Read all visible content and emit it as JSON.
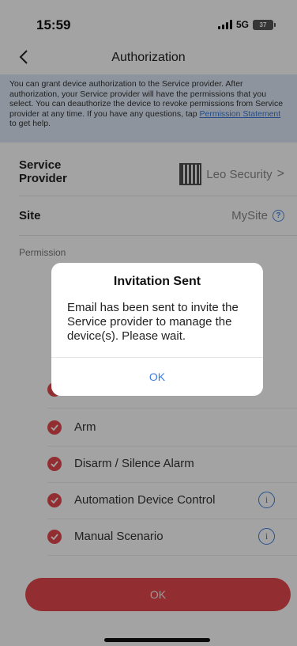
{
  "status_bar": {
    "time": "15:59",
    "network": "5G",
    "battery": "37"
  },
  "nav": {
    "title": "Authorization",
    "back_icon": "chevron-left-icon"
  },
  "info": {
    "text_before": "You can grant device authorization to the Service provider. After authorization, your Service provider will have the permissions that you select. You can deauthorize the device to revoke permissions from Service provider at any time. If you have any questions, tap ",
    "link": "Permission Statement",
    "text_after": " to get help."
  },
  "service_provider": {
    "label": "Service Provider",
    "value": "Leo Security",
    "chevron": ">"
  },
  "site": {
    "label": "Site",
    "value": "MySite",
    "help": "?"
  },
  "permission": {
    "title": "Permission",
    "items": [
      {
        "label": "Arm",
        "info": false
      },
      {
        "label": "Disarm / Silence Alarm",
        "info": false
      },
      {
        "label": "Automation Device Control",
        "info": true
      },
      {
        "label": "Manual Scenario",
        "info": true
      }
    ]
  },
  "bottom_button": {
    "label": "OK"
  },
  "dialog": {
    "title": "Invitation Sent",
    "message": "Email has been sent to invite the Service provider to manage the device(s). Please wait.",
    "ok": "OK"
  },
  "colors": {
    "accent_red": "#e5484d",
    "link_blue": "#3a7fe0",
    "info_bg": "#dde8f6"
  }
}
